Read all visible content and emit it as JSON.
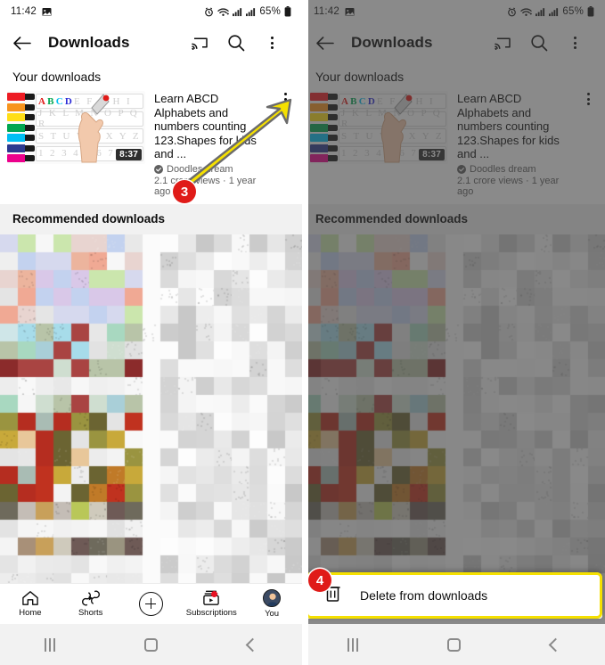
{
  "status_bar": {
    "time": "11:42",
    "battery_percent": "65%",
    "icons": [
      "photo-icon",
      "alarm-icon",
      "wifi-icon",
      "signal-icon",
      "signal-icon",
      "battery-icon"
    ]
  },
  "app_bar": {
    "back_label": "back-arrow",
    "title": "Downloads",
    "actions": [
      "cast-icon",
      "search-icon",
      "overflow-menu-icon"
    ]
  },
  "sections": {
    "your_downloads": "Your downloads",
    "recommended_downloads": "Recommended downloads"
  },
  "video": {
    "title": "Learn ABCD Alphabets and numbers counting 123.Shapes for kids and ...",
    "channel": "Doodles dream",
    "stats": "2.1 crore views · 1 year ago",
    "duration": "8:37",
    "thumbnail_rows": [
      "A B C D E F G H I",
      "J K L M N O P Q R",
      "S T U V W X Y Z",
      "1 2 3 4 5 6 7 8 9"
    ]
  },
  "bottom_nav": {
    "items": [
      {
        "label": "Home",
        "icon": "home-icon"
      },
      {
        "label": "Shorts",
        "icon": "shorts-icon"
      },
      {
        "label": "",
        "icon": "create-plus-icon"
      },
      {
        "label": "Subscriptions",
        "icon": "subscriptions-icon"
      },
      {
        "label": "You",
        "icon": "account-avatar-icon"
      }
    ]
  },
  "android_nav": {
    "recent": "recents-button",
    "home": "home-button",
    "back": "back-button"
  },
  "bottom_sheet": {
    "delete_label": "Delete from downloads",
    "delete_icon": "trash-icon"
  },
  "annotations": {
    "step_3": "3",
    "step_4": "4",
    "arrow_color": "#f5e000",
    "badge_color": "#e01b18",
    "highlight_color": "#f5e000"
  }
}
